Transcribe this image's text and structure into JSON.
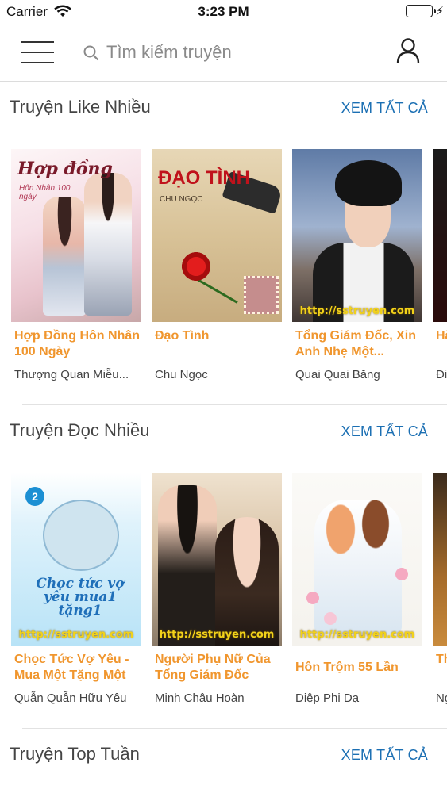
{
  "status_bar": {
    "carrier": "Carrier",
    "time": "3:23 PM",
    "battery_level": 1.0,
    "colors": {
      "battery": "#35c04a"
    }
  },
  "nav": {
    "menu_icon": "hamburger-menu-icon",
    "search_icon": "search-icon",
    "search_placeholder": "Tìm kiếm truyện",
    "search_value": "",
    "user_icon": "user-icon"
  },
  "theme": {
    "accent": "#1b6fb3",
    "book_title_color": "#f0962e"
  },
  "sections": [
    {
      "title": "Truyện Like Nhiều",
      "see_all": "XEM TẤT CẢ",
      "books": [
        {
          "title": "Hợp Đồng Hôn Nhân 100 Ngày",
          "author": "Thượng Quan Miễu...",
          "cover_text": "Hợp đồng",
          "cover_sub": "Hôn Nhân 100 ngày"
        },
        {
          "title": "Đạo Tình",
          "author": "Chu Ngọc",
          "cover_text": "ĐẠO TÌNH",
          "cover_sub": "CHU NGỌC"
        },
        {
          "title": "Tổng Giám Đốc, Xin Anh Nhẹ Một...",
          "author": "Quai Quai Băng",
          "cover_text": "http://sstruyen.com"
        },
        {
          "title": "Hà An",
          "author": "Đi"
        }
      ]
    },
    {
      "title": "Truyện Đọc Nhiều",
      "see_all": "XEM TẤT CẢ",
      "books": [
        {
          "title": "Chọc Tức Vợ Yêu - Mua Một Tặng Một",
          "author": "Quẫn Quẫn Hữu Yêu",
          "cover_text": "Chọc tức vợ yêu mua1 tặng1",
          "cover_badge": "2",
          "watermark": "http://sstruyen.com"
        },
        {
          "title": "Người Phụ Nữ Của Tổng Giám Đốc",
          "author": "Minh Châu Hoàn",
          "watermark": "http://sstruyen.com"
        },
        {
          "title": "Hôn Trộm 55 Lần",
          "author": "Diệp Phi Dạ",
          "watermark": "http://sstruyen.com"
        },
        {
          "title": "Th Th",
          "author": "Ng"
        }
      ]
    },
    {
      "title": "Truyện Top Tuần",
      "see_all": "XEM TẤT CẢ"
    }
  ]
}
